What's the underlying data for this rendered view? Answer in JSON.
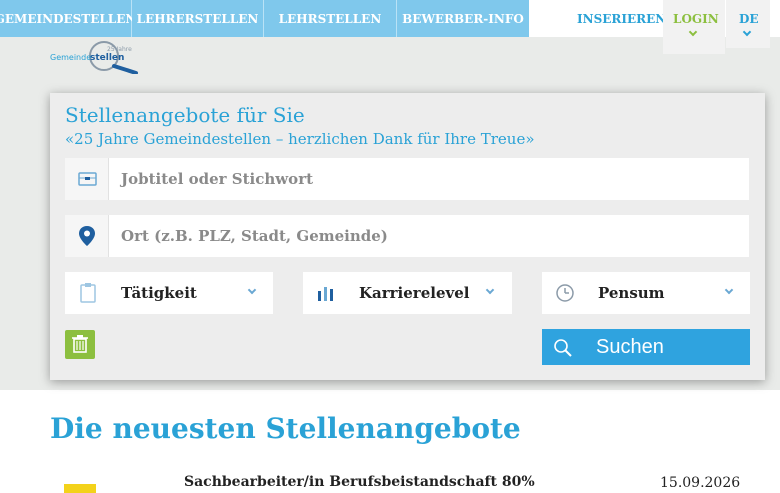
{
  "nav": {
    "items": [
      "GEMEINDESTELLEN",
      "LEHRERSTELLEN",
      "LEHRSTELLEN",
      "BEWERBER-INFO"
    ],
    "inserieren": "INSERIEREN",
    "login": "LOGIN",
    "lang": "DE"
  },
  "logo": {
    "line1": "25 Jahre",
    "line2a": "Gemeinde",
    "line2b": "stellen"
  },
  "search": {
    "title": "Stellenangebote für Sie",
    "subtitle": "«25 Jahre Gemeindestellen – herzlichen Dank für Ihre Treue»",
    "keyword_placeholder": "Jobtitel oder Stichwort",
    "location_placeholder": "Ort (z.B. PLZ, Stadt, Gemeinde)",
    "filters": [
      "Tätigkeit",
      "Karrierelevel",
      "Pensum"
    ],
    "submit": "Suchen"
  },
  "listing": {
    "heading": "Die neuesten Stellenangebote",
    "jobs": [
      {
        "title": "Sachbearbeiter/in Berufsbeistandschaft 80%",
        "date": "15.09.2026"
      }
    ]
  },
  "colors": {
    "nav_blue": "#7fc8ec",
    "accent_blue": "#2aa2d6",
    "login_green": "#8cbf3f",
    "button_blue": "#2fa3df"
  }
}
